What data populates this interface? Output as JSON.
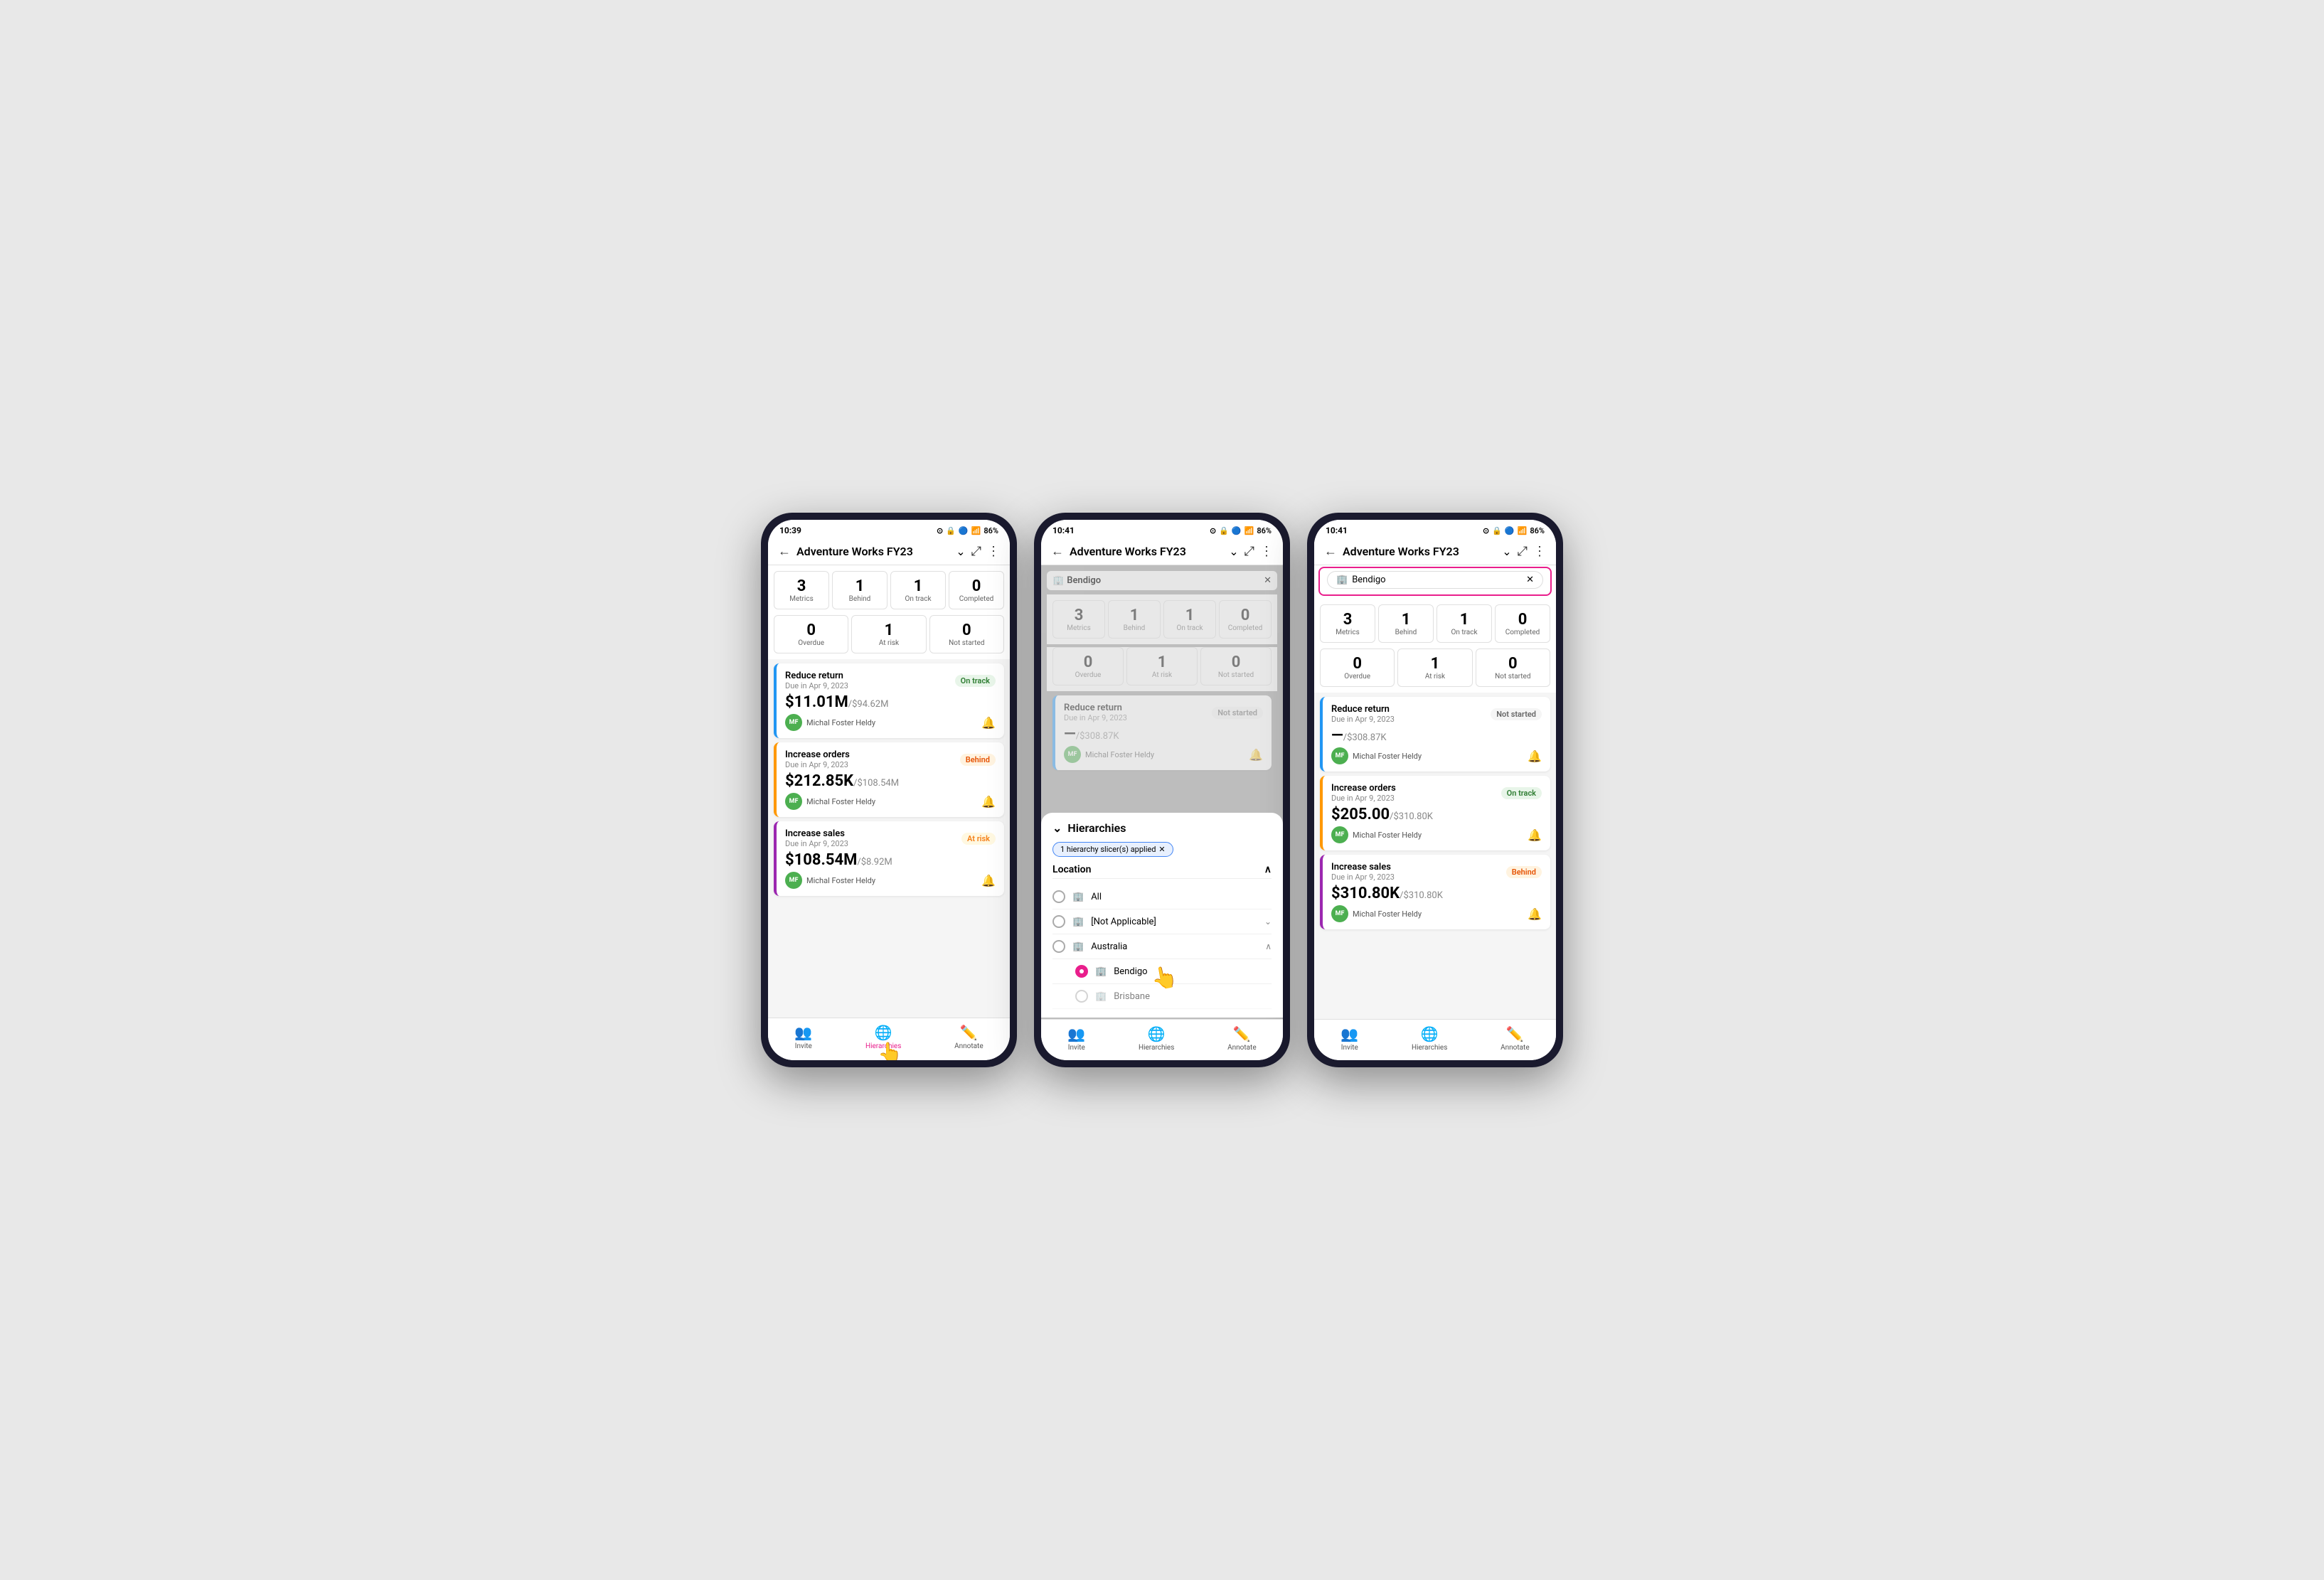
{
  "colors": {
    "onTrack": "#2e7d32",
    "behind": "#e65100",
    "atRisk": "#f57f17",
    "notStarted": "#666",
    "accent": "#e91e8c",
    "blue": "#2196F3",
    "orange": "#FF9800",
    "purple": "#9C27B0"
  },
  "phone1": {
    "statusBar": {
      "time": "10:39",
      "battery": "86%"
    },
    "header": {
      "title": "Adventure Works FY23",
      "backIcon": "←",
      "expandIcon": "⤢",
      "moreIcon": "⋮"
    },
    "metrics": [
      {
        "number": "3",
        "label": "Metrics"
      },
      {
        "number": "1",
        "label": "Behind"
      },
      {
        "number": "1",
        "label": "On track"
      },
      {
        "number": "0",
        "label": "Completed"
      }
    ],
    "metrics2": [
      {
        "number": "0",
        "label": "Overdue"
      },
      {
        "number": "1",
        "label": "At risk"
      },
      {
        "number": "0",
        "label": "Not started"
      }
    ],
    "kpis": [
      {
        "title": "Reduce return",
        "due": "Due in Apr 9, 2023",
        "badge": "On track",
        "badgeClass": "badge-on-track",
        "value": "$11.01M",
        "target": "/$94.62M",
        "owner": "Michal Foster Heldy",
        "avatarInitials": "MF",
        "color": "blue"
      },
      {
        "title": "Increase orders",
        "due": "Due in Apr 9, 2023",
        "badge": "Behind",
        "badgeClass": "badge-behind",
        "value": "$212.85K",
        "target": "/$108.54M",
        "owner": "Michal Foster Heldy",
        "avatarInitials": "MF",
        "color": "orange"
      },
      {
        "title": "Increase sales",
        "due": "Due in Apr 9, 2023",
        "badge": "At risk",
        "badgeClass": "badge-at-risk",
        "value": "$108.54M",
        "target": "/$8.92M",
        "owner": "Michal Foster Heldy",
        "avatarInitials": "MF",
        "color": "purple"
      }
    ],
    "bottomNav": [
      {
        "icon": "👥",
        "label": "Invite",
        "active": false
      },
      {
        "icon": "🌐",
        "label": "Hierarchies",
        "active": true
      },
      {
        "icon": "✏️",
        "label": "Annotate",
        "active": false
      }
    ]
  },
  "phone2": {
    "statusBar": {
      "time": "10:41",
      "battery": "86%"
    },
    "header": {
      "title": "Adventure Works FY23"
    },
    "filterChip": "Bendigo",
    "kpis": [
      {
        "title": "Reduce return",
        "due": "Due in Apr 9, 2023",
        "badge": "Not started",
        "badgeClass": "badge-not-started",
        "value": "—",
        "target": "/$308.87K",
        "owner": "Michal Foster Heldy",
        "avatarInitials": "MF",
        "color": "blue"
      }
    ],
    "hierarchyPanel": {
      "title": "Hierarchies",
      "filterLabel": "1 hierarchy slicer(s) applied",
      "locationLabel": "Location",
      "items": [
        {
          "label": "All",
          "selected": false,
          "hasChildren": false
        },
        {
          "label": "[Not Applicable]",
          "selected": false,
          "hasChildren": true,
          "expanded": false
        },
        {
          "label": "Australia",
          "selected": false,
          "hasChildren": true,
          "expanded": true
        },
        {
          "label": "Bendigo",
          "selected": true,
          "hasChildren": false,
          "indent": true
        },
        {
          "label": "Brisbane",
          "selected": false,
          "hasChildren": false,
          "indent": true,
          "partial": true
        }
      ]
    },
    "bottomNav": [
      {
        "icon": "👥",
        "label": "Invite",
        "active": false
      },
      {
        "icon": "🌐",
        "label": "Hierarchies",
        "active": false
      },
      {
        "icon": "✏️",
        "label": "Annotate",
        "active": false
      }
    ]
  },
  "phone3": {
    "statusBar": {
      "time": "10:41",
      "battery": "86%"
    },
    "header": {
      "title": "Adventure Works FY23"
    },
    "filterChip": "Bendigo",
    "metrics": [
      {
        "number": "3",
        "label": "Metrics"
      },
      {
        "number": "1",
        "label": "Behind"
      },
      {
        "number": "1",
        "label": "On track"
      },
      {
        "number": "0",
        "label": "Completed"
      }
    ],
    "metrics2": [
      {
        "number": "0",
        "label": "Overdue"
      },
      {
        "number": "1",
        "label": "At risk"
      },
      {
        "number": "0",
        "label": "Not started"
      }
    ],
    "kpis": [
      {
        "title": "Reduce return",
        "due": "Due in Apr 9, 2023",
        "badge": "Not started",
        "badgeClass": "badge-not-started",
        "value": "—",
        "target": "/$308.87K",
        "owner": "Michal Foster Heldy",
        "avatarInitials": "MF",
        "color": "blue"
      },
      {
        "title": "Increase orders",
        "due": "Due in Apr 9, 2023",
        "badge": "On track",
        "badgeClass": "badge-on-track",
        "value": "$205.00",
        "target": "/$310.80K",
        "owner": "Michal Foster Heldy",
        "avatarInitials": "MF",
        "color": "orange"
      },
      {
        "title": "Increase sales",
        "due": "Due in Apr 9, 2023",
        "badge": "Behind",
        "badgeClass": "badge-behind",
        "value": "$310.80K",
        "target": "/$310.80K",
        "owner": "Michal Foster Heldy",
        "avatarInitials": "MF",
        "color": "purple"
      }
    ],
    "bottomNav": [
      {
        "icon": "👥",
        "label": "Invite",
        "active": false
      },
      {
        "icon": "🌐",
        "label": "Hierarchies",
        "active": false
      },
      {
        "icon": "✏️",
        "label": "Annotate",
        "active": false
      }
    ]
  }
}
